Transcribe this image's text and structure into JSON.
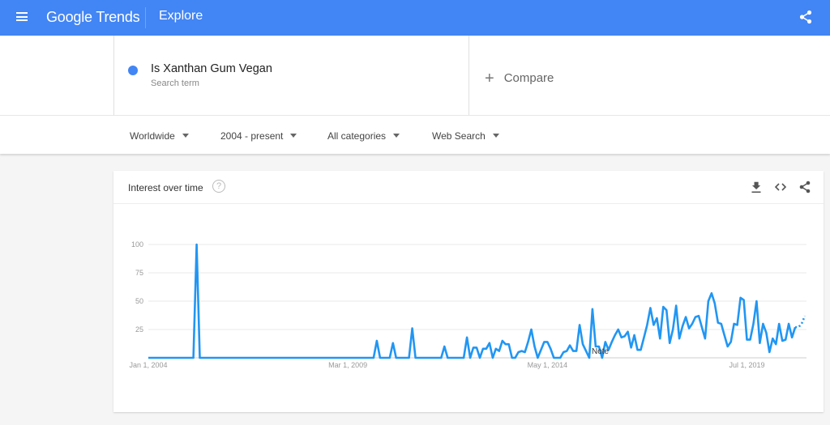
{
  "header": {
    "menu_icon": "hamburger-menu-icon",
    "logo_google": "Google",
    "logo_trends": "Trends",
    "page": "Explore",
    "share_icon": "share-icon"
  },
  "search": {
    "term": "Is Xanthan Gum Vegan",
    "term_type": "Search term",
    "term_color": "#4285f4",
    "compare_label": "Compare",
    "compare_icon": "plus-icon"
  },
  "filters": [
    {
      "label": "Worldwide"
    },
    {
      "label": "2004 - present"
    },
    {
      "label": "All categories"
    },
    {
      "label": "Web Search"
    }
  ],
  "card": {
    "title": "Interest over time",
    "help_icon": "help-icon",
    "actions": [
      "download-icon",
      "embed-icon",
      "share-icon"
    ],
    "note_label": "Note"
  },
  "chart_data": {
    "type": "line",
    "title": "Interest over time",
    "xlabel": "",
    "ylabel": "",
    "ylim": [
      0,
      100
    ],
    "y_ticks": [
      25,
      50,
      75,
      100
    ],
    "x_ticks": [
      "Jan 1, 2004",
      "Mar 1, 2009",
      "May 1, 2014",
      "Jul 1, 2019"
    ],
    "x_tick_index": [
      0,
      62,
      124,
      186
    ],
    "grid": true,
    "line_color": "#2196f3",
    "series": [
      {
        "name": "Is Xanthan Gum Vegan",
        "values": [
          0,
          0,
          0,
          0,
          0,
          0,
          0,
          0,
          0,
          0,
          0,
          0,
          0,
          0,
          0,
          100,
          0,
          0,
          0,
          0,
          0,
          0,
          0,
          0,
          0,
          0,
          0,
          0,
          0,
          0,
          0,
          0,
          0,
          0,
          0,
          0,
          0,
          0,
          0,
          0,
          0,
          0,
          0,
          0,
          0,
          0,
          0,
          0,
          0,
          0,
          0,
          0,
          0,
          0,
          0,
          0,
          0,
          0,
          0,
          0,
          0,
          0,
          0,
          0,
          0,
          0,
          0,
          0,
          0,
          0,
          0,
          15,
          0,
          0,
          0,
          0,
          13,
          0,
          0,
          0,
          0,
          0,
          26,
          0,
          0,
          0,
          0,
          0,
          0,
          0,
          0,
          0,
          10,
          0,
          0,
          0,
          0,
          0,
          0,
          18,
          0,
          9,
          9,
          0,
          8,
          8,
          13,
          0,
          8,
          6,
          15,
          12,
          12,
          0,
          0,
          5,
          6,
          5,
          14,
          25,
          10,
          0,
          7,
          14,
          14,
          8,
          0,
          0,
          0,
          5,
          6,
          11,
          6,
          6,
          29,
          12,
          6,
          0,
          43,
          10,
          10,
          0,
          14,
          7,
          14,
          20,
          25,
          18,
          19,
          23,
          9,
          20,
          7,
          7,
          18,
          29,
          44,
          29,
          35,
          17,
          45,
          42,
          13,
          25,
          46,
          17,
          28,
          36,
          26,
          30,
          36,
          37,
          27,
          17,
          50,
          57,
          48,
          31,
          30,
          20,
          10,
          14,
          30,
          29,
          53,
          51,
          16,
          16,
          30,
          50,
          13,
          30,
          22,
          5,
          17,
          12,
          30,
          15,
          16,
          30,
          18,
          27
        ],
        "partial_values": [
          27,
          30,
          37
        ]
      }
    ],
    "annotations": [
      "Note"
    ]
  }
}
